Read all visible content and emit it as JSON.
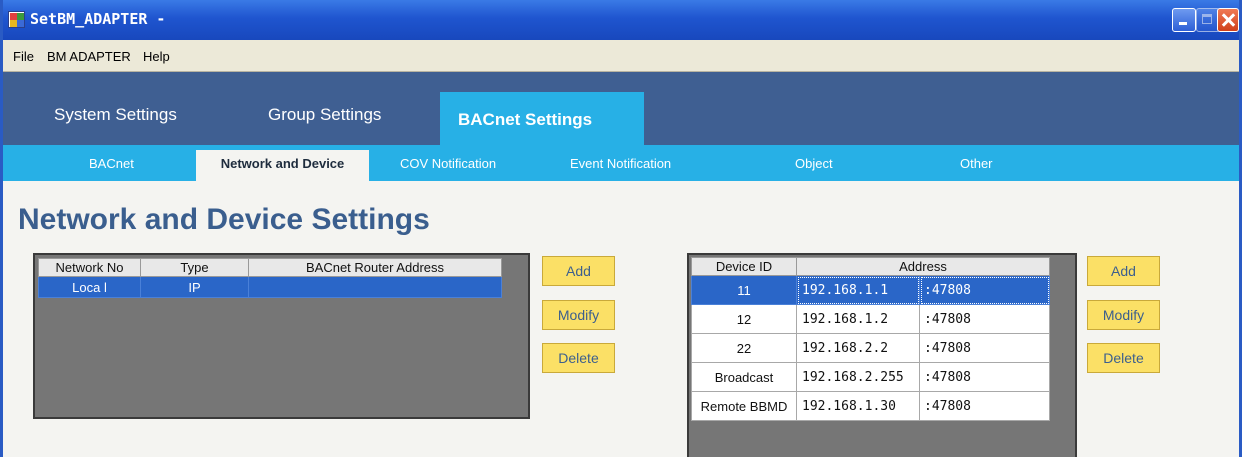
{
  "window": {
    "title": "SetBM_ADAPTER -"
  },
  "menu": [
    {
      "label": "File"
    },
    {
      "label": "BM ADAPTER"
    },
    {
      "label": "Help"
    }
  ],
  "main_tabs": [
    {
      "label": "System Settings"
    },
    {
      "label": "Group Settings"
    },
    {
      "label": "BACnet Settings"
    }
  ],
  "sub_tabs": [
    {
      "label": "BACnet"
    },
    {
      "label": "Network and Device"
    },
    {
      "label": "COV Notification"
    },
    {
      "label": "Event Notification"
    },
    {
      "label": "Object"
    },
    {
      "label": "Other"
    }
  ],
  "page_title": "Network and Device Settings",
  "network_table": {
    "columns": [
      "Network No",
      "Type",
      "BACnet Router Address"
    ],
    "rows": [
      {
        "network_no": "Loca l",
        "type": "IP",
        "router": ""
      }
    ]
  },
  "device_table": {
    "columns": [
      "Device ID",
      "Address"
    ],
    "rows": [
      {
        "id": "11",
        "ip": "192.168.1.1",
        "port": ":47808"
      },
      {
        "id": "12",
        "ip": "192.168.1.2",
        "port": ":47808"
      },
      {
        "id": "22",
        "ip": "192.168.2.2",
        "port": ":47808"
      },
      {
        "id": "Broadcast",
        "ip": "192.168.2.255",
        "port": ":47808"
      },
      {
        "id": "Remote BBMD",
        "ip": "192.168.1.30",
        "port": ":47808"
      }
    ]
  },
  "buttons": {
    "add": "Add",
    "modify": "Modify",
    "delete": "Delete"
  },
  "colors": {
    "titlebar": "#1f55cf",
    "tabbar": "#3f5f92",
    "subtabbar": "#27b0e6",
    "selection": "#2a66c8",
    "button": "#fbe066",
    "title_text": "#3a5e8e"
  }
}
